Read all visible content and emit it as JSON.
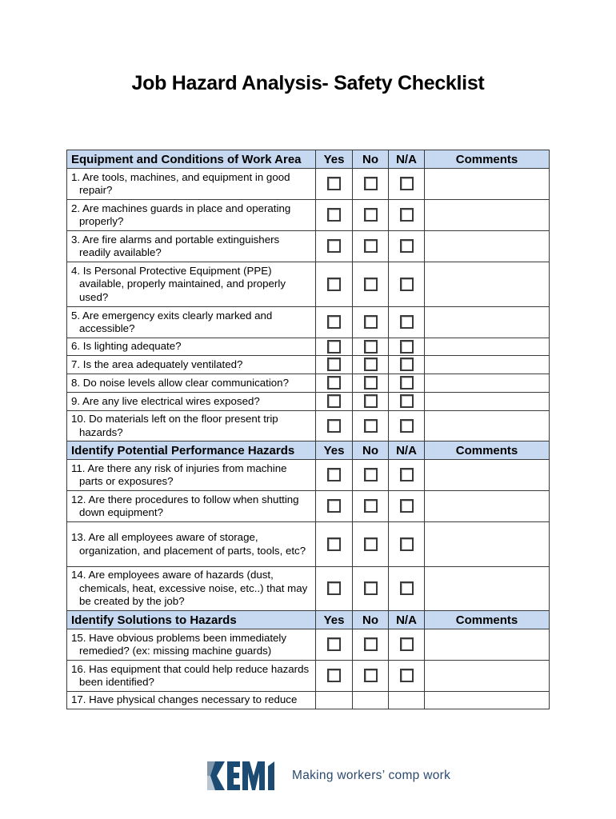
{
  "document": {
    "title": "Job Hazard Analysis- Safety Checklist"
  },
  "columns": {
    "yes": "Yes",
    "no": "No",
    "na": "N/A",
    "comments": "Comments"
  },
  "sections": [
    {
      "heading": "Equipment and Conditions of Work Area",
      "questions": [
        "1. Are tools, machines, and equipment in good repair?",
        "2. Are machines guards in place and operating properly?",
        "3. Are fire alarms and portable extinguishers readily available?",
        "4. Is Personal Protective Equipment (PPE) available, properly maintained, and properly used?",
        "5. Are emergency exits clearly marked and accessible?",
        "6. Is lighting adequate?",
        "7. Is the area adequately ventilated?",
        "8. Do noise levels allow clear communication?",
        "9. Are any live electrical wires exposed?",
        "10. Do materials left on the floor present trip hazards?"
      ]
    },
    {
      "heading": "Identify Potential Performance Hazards",
      "questions": [
        "11. Are there any risk of injuries from machine parts or exposures?",
        "12. Are there procedures to follow when shutting down equipment?",
        "13. Are all employees aware of storage, organization, and placement of parts, tools, etc?",
        "14. Are employees aware of hazards (dust, chemicals, heat, excessive noise, etc..) that may be created by the job?"
      ]
    },
    {
      "heading": "Identify Solutions to Hazards",
      "questions": [
        "15. Have obvious problems been immediately remedied? (ex: missing machine guards)",
        "16. Has equipment that could help reduce hazards been identified?",
        "17. Have physical changes necessary to reduce"
      ]
    }
  ],
  "footer": {
    "logo_text": "KEMI",
    "tagline": "Making workers’ comp work",
    "brand_color": "#1b4a72"
  },
  "colors": {
    "header_fill": "#c6d9f1",
    "border": "#3a3a3a"
  }
}
